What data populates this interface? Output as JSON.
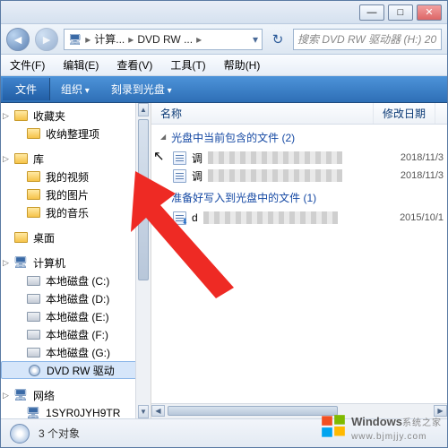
{
  "titlebar": {
    "min": "—",
    "max": "□",
    "close": "✕"
  },
  "nav": {
    "back": "◄",
    "fwd": "►"
  },
  "breadcrumb": {
    "seg1": "计算...",
    "seg2": "DVD RW ...",
    "refresh": "↻"
  },
  "search": {
    "placeholder": "搜索 DVD RW 驱动器 (H:) 20"
  },
  "menu": {
    "file": "文件(F)",
    "edit": "编辑(E)",
    "view": "查看(V)",
    "tools": "工具(T)",
    "help": "帮助(H)"
  },
  "cmd": {
    "file": "文件",
    "org": "组织",
    "burn": "刻录到光盘"
  },
  "sidebar": {
    "items": [
      {
        "label": "收藏夹",
        "kind": "folder",
        "root": true,
        "tri": true
      },
      {
        "label": "收纳整理项",
        "kind": "folder"
      },
      {
        "label": "库",
        "kind": "folder",
        "root": true,
        "tri": true,
        "gap": true
      },
      {
        "label": "我的视频",
        "kind": "folder"
      },
      {
        "label": "我的图片",
        "kind": "folder"
      },
      {
        "label": "我的音乐",
        "kind": "folder"
      },
      {
        "label": "桌面",
        "kind": "folder",
        "root": true,
        "gap": true
      },
      {
        "label": "计算机",
        "kind": "pc",
        "root": true,
        "tri": true,
        "gap": true
      },
      {
        "label": "本地磁盘 (C:)",
        "kind": "drive"
      },
      {
        "label": "本地磁盘 (D:)",
        "kind": "drive"
      },
      {
        "label": "本地磁盘 (E:)",
        "kind": "drive"
      },
      {
        "label": "本地磁盘 (F:)",
        "kind": "drive"
      },
      {
        "label": "本地磁盘 (G:)",
        "kind": "drive"
      },
      {
        "label": "DVD RW 驱动",
        "kind": "disc",
        "sel": true
      },
      {
        "label": "网络",
        "kind": "pc",
        "root": true,
        "tri": true,
        "gap": true
      },
      {
        "label": "1SYR0JYH9TR",
        "kind": "pc"
      }
    ]
  },
  "cols": {
    "name": "名称",
    "date": "修改日期"
  },
  "groups": [
    {
      "title": "光盘中当前包含的文件 (2)",
      "rows": [
        {
          "label": "调",
          "pixelated": true,
          "date": "2018/11/3"
        },
        {
          "label": "调",
          "pixelated": true,
          "date": "2018/11/3"
        }
      ]
    },
    {
      "title": "准备好写入到光盘中的文件 (1)",
      "rows": [
        {
          "label": "d",
          "pixelated": true,
          "date": "2015/10/1",
          "down": true
        }
      ]
    }
  ],
  "status": {
    "text": "3 个对象"
  },
  "watermark": {
    "brand": "Windows",
    "sub": "系统之家",
    "domain": "www.bjmjjy.com"
  }
}
